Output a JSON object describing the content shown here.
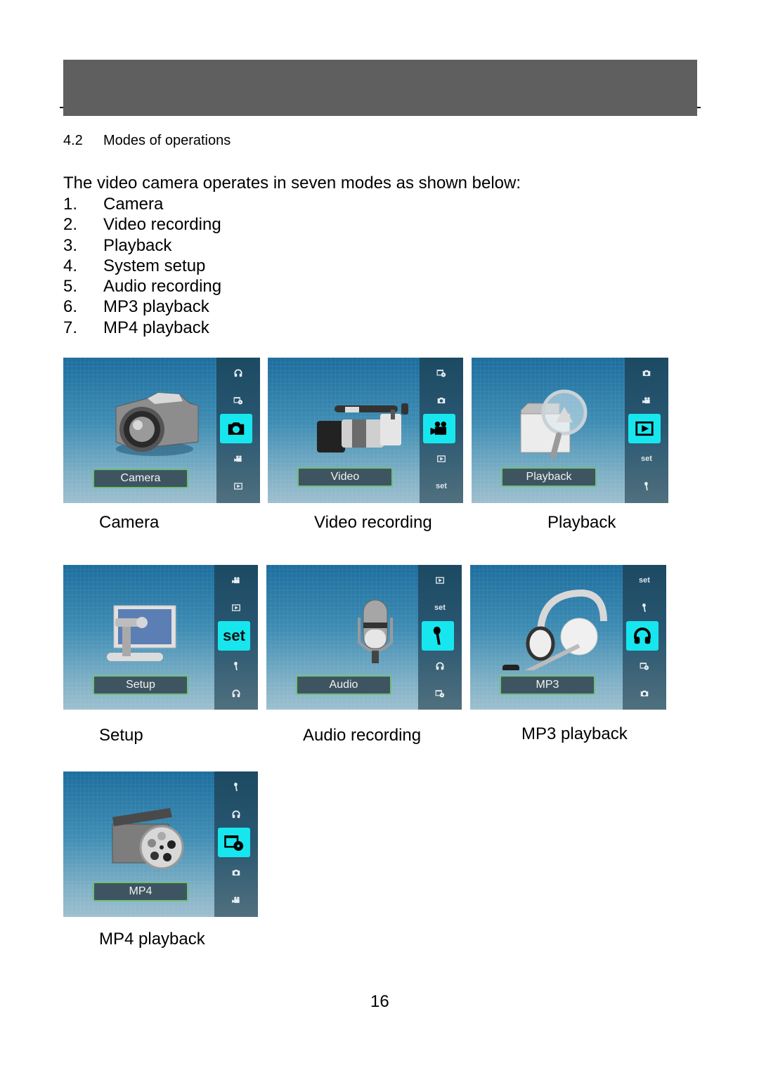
{
  "header": {
    "bar_color": "#5f5f5f"
  },
  "section": {
    "number": "4.2",
    "title": "Modes of operations"
  },
  "intro": "The video camera operates in seven modes as shown below:",
  "modes": [
    {
      "n": "1.",
      "label": "Camera"
    },
    {
      "n": "2.",
      "label": "Video recording"
    },
    {
      "n": "3.",
      "label": "Playback"
    },
    {
      "n": "4.",
      "label": "System setup"
    },
    {
      "n": "5.",
      "label": "Audio recording"
    },
    {
      "n": "6.",
      "label": "MP3 playback"
    },
    {
      "n": "7.",
      "label": "MP4 playback"
    }
  ],
  "accent_color": "#18e6ee",
  "screens": [
    {
      "id": "camera",
      "label": "Camera",
      "caption": "Camera",
      "sidebar": [
        "headphones-icon",
        "mp4-icon",
        "camera-icon",
        "video-icon",
        "playback-icon"
      ],
      "active_index": 2
    },
    {
      "id": "video",
      "label": "Video",
      "caption": "Video recording",
      "sidebar": [
        "mp4-icon",
        "camera-icon",
        "video-icon",
        "playback-icon",
        "set"
      ],
      "active_index": 2
    },
    {
      "id": "playback",
      "label": "Playback",
      "caption": "Playback",
      "sidebar": [
        "camera-icon",
        "video-icon",
        "playback-icon",
        "set",
        "microphone-icon"
      ],
      "active_index": 2
    },
    {
      "id": "setup",
      "label": "Setup",
      "caption": "Setup",
      "sidebar": [
        "video-icon",
        "playback-icon",
        "set",
        "microphone-icon",
        "headphones-icon"
      ],
      "active_index": 2
    },
    {
      "id": "audio",
      "label": "Audio",
      "caption": "Audio recording",
      "sidebar": [
        "playback-icon",
        "set",
        "microphone-icon",
        "headphones-icon",
        "mp4-icon"
      ],
      "active_index": 2
    },
    {
      "id": "mp3",
      "label": "MP3",
      "caption": "MP3 playback",
      "sidebar": [
        "set",
        "microphone-icon",
        "headphones-icon",
        "mp4-icon",
        "camera-icon"
      ],
      "active_index": 2
    },
    {
      "id": "mp4",
      "label": "MP4",
      "caption": "MP4 playback",
      "sidebar": [
        "microphone-icon",
        "headphones-icon",
        "mp4-icon",
        "camera-icon",
        "video-icon"
      ],
      "active_index": 2
    }
  ],
  "set_text": "set",
  "page_number": "16"
}
